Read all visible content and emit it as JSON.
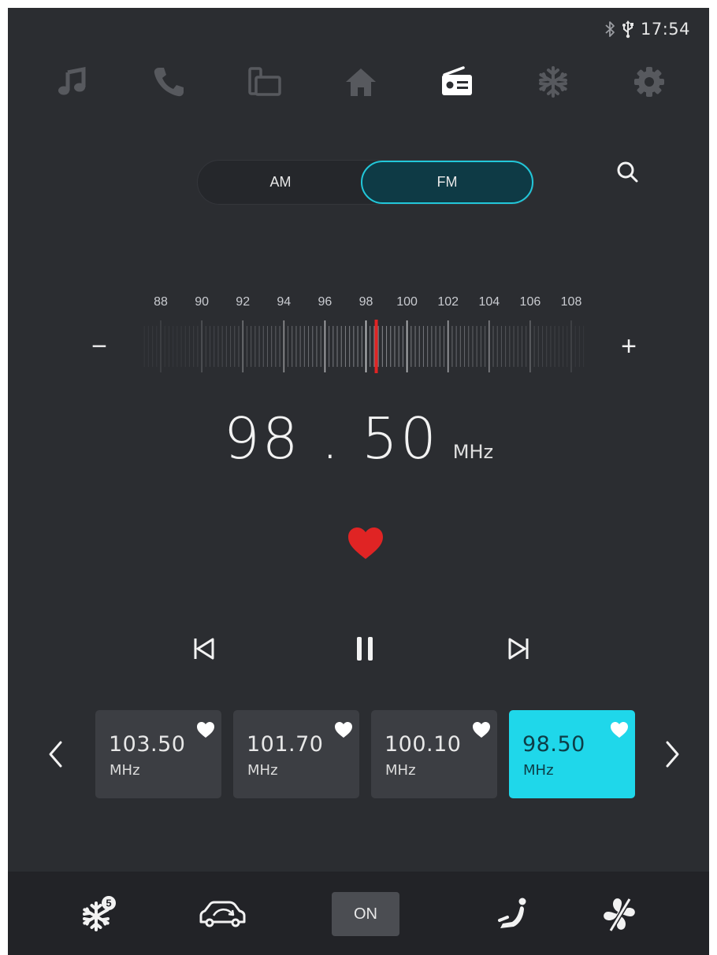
{
  "status": {
    "time": "17:54",
    "icons": [
      "bluetooth-icon",
      "usb-icon"
    ]
  },
  "nav": {
    "items": [
      {
        "icon": "music-note-icon",
        "active": false
      },
      {
        "icon": "phone-icon",
        "active": false
      },
      {
        "icon": "devices-icon",
        "active": false
      },
      {
        "icon": "home-icon",
        "active": false
      },
      {
        "icon": "radio-icon",
        "active": true
      },
      {
        "icon": "snowflake-icon",
        "active": false
      },
      {
        "icon": "gear-icon",
        "active": false
      }
    ]
  },
  "band": {
    "am_label": "AM",
    "fm_label": "FM",
    "selected": "FM"
  },
  "tuner": {
    "scale_labels": [
      "88",
      "90",
      "92",
      "94",
      "96",
      "98",
      "100",
      "102",
      "104",
      "106",
      "108"
    ],
    "min": 88,
    "max": 108,
    "current": 98.5,
    "minus_label": "−",
    "plus_label": "+",
    "indicator_color": "#e02424"
  },
  "frequency": {
    "value": "98 . 50",
    "unit": "MHz",
    "favorited": true
  },
  "presets": [
    {
      "freq": "103.50",
      "unit": "MHz",
      "active": false
    },
    {
      "freq": "101.70",
      "unit": "MHz",
      "active": false
    },
    {
      "freq": "100.10",
      "unit": "MHz",
      "active": false
    },
    {
      "freq": "98.50",
      "unit": "MHz",
      "active": true
    }
  ],
  "climate": {
    "ac_level": "5",
    "on_label": "ON"
  },
  "colors": {
    "accent": "#1fd7ea",
    "heart": "#e02424",
    "background": "#2b2d31"
  }
}
